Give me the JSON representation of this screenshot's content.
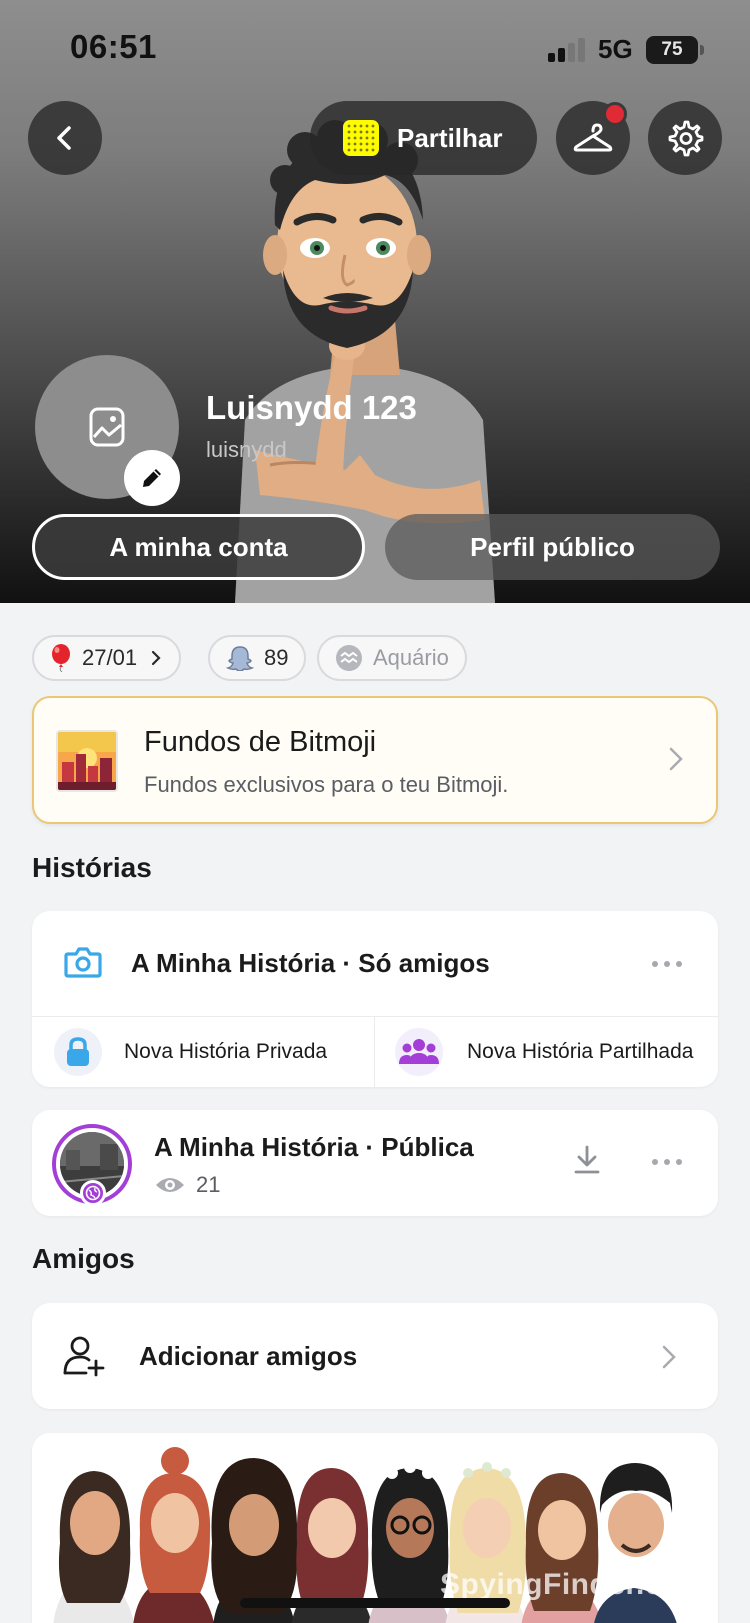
{
  "status_bar": {
    "time": "06:51",
    "network": "5G",
    "battery": "75"
  },
  "header": {
    "share_label": "Partilhar",
    "display_name": "Luisnydd 123",
    "username": "luisnydd",
    "my_account_label": "A minha conta",
    "public_profile_label": "Perfil público"
  },
  "chips": {
    "birthday": "27/01",
    "friends_count": "89",
    "zodiac": "Aquário"
  },
  "bitmoji_backgrounds": {
    "title": "Fundos de Bitmoji",
    "subtitle": "Fundos exclusivos para o teu Bitmoji."
  },
  "stories": {
    "section_title": "Histórias",
    "my_story_title": "A Minha História · Só amigos",
    "new_private": "Nova História Privada",
    "new_shared": "Nova História Partilhada",
    "public_story_title": "A Minha História · Pública",
    "public_views": "21"
  },
  "friends": {
    "section_title": "Amigos",
    "add_friends_label": "Adicionar amigos"
  },
  "watermark": "SpyingFinder.com",
  "colors": {
    "accent_purple": "#a33ed6",
    "snap_yellow": "#fffc00",
    "notification_red": "#e02a35",
    "camera_blue": "#3aa7e8",
    "gold_border": "#e9c777"
  }
}
